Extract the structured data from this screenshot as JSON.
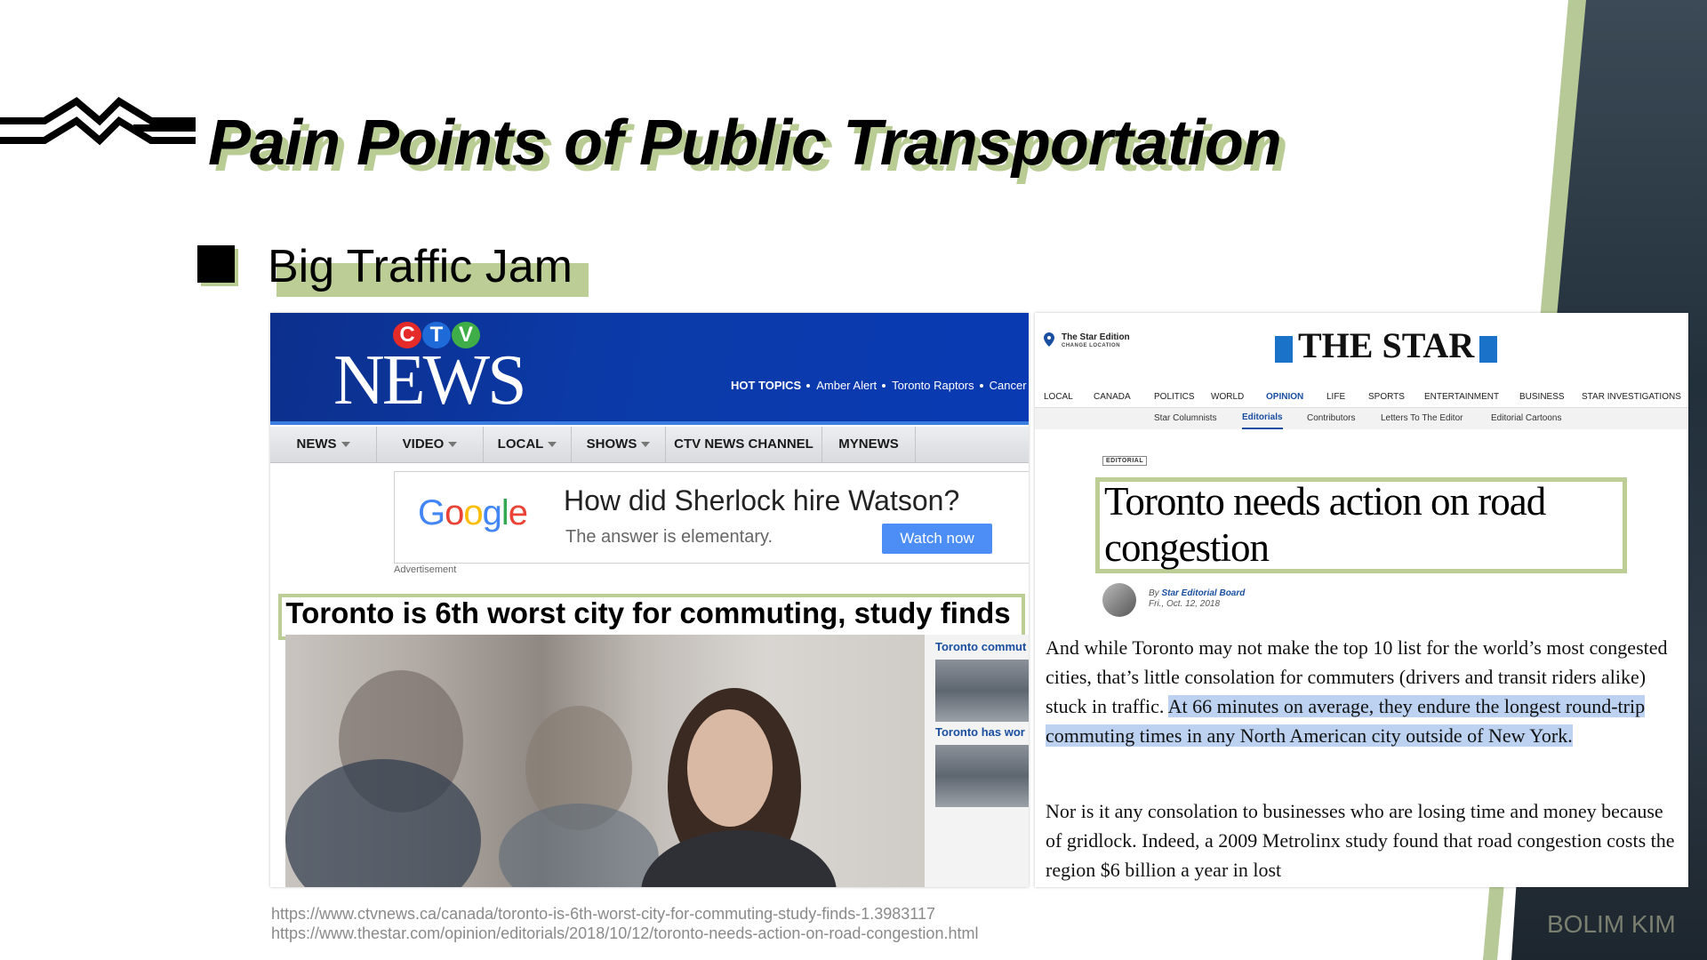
{
  "title": "Pain Points of Public Transportation",
  "subtitle": "Big Traffic Jam",
  "ctv": {
    "logo_letters": [
      "C",
      "T",
      "V"
    ],
    "logo_word": "NEWS",
    "hot_topics_label": "HOT TOPICS",
    "hot_topics": [
      "Amber Alert",
      "Toronto Raptors",
      "Cancer"
    ],
    "nav": [
      "NEWS",
      "VIDEO",
      "LOCAL",
      "SHOWS",
      "CTV NEWS CHANNEL",
      "MYNEWS"
    ],
    "ad": {
      "brand": "Google",
      "headline": "How did Sherlock hire Watson?",
      "sub": "The answer is elementary.",
      "button": "Watch now",
      "label": "Advertisement"
    },
    "headline": "Toronto is 6th worst city for commuting, study finds",
    "related": [
      "Toronto commut",
      "Toronto has wor"
    ]
  },
  "star": {
    "edition": "The Star Edition",
    "change_location": "CHANGE LOCATION",
    "logo": "THE STAR",
    "nav": [
      "LOCAL",
      "CANADA",
      "POLITICS",
      "WORLD",
      "OPINION",
      "LIFE",
      "SPORTS",
      "ENTERTAINMENT",
      "BUSINESS",
      "STAR INVESTIGATIONS"
    ],
    "active_nav": "OPINION",
    "subnav": [
      "Star Columnists",
      "Editorials",
      "Contributors",
      "Letters To The Editor",
      "Editorial Cartoons"
    ],
    "active_subnav": "Editorials",
    "tag": "EDITORIAL",
    "headline": "Toronto needs action on road congestion",
    "by": "By",
    "author": "Star Editorial Board",
    "date": "Fri., Oct. 12, 2018",
    "para1_plain": "And while Toronto may not make the top 10 list for the world’s most congested cities, that’s little consolation for commuters (drivers and transit riders alike) stuck in traffic. ",
    "para1_highlight": "At 66 minutes on average, they endure the longest round-trip commuting times in any North American city outside of New York.",
    "para2": "Nor is it any consolation to businesses who are losing time and money because of gridlock. Indeed, a 2009 Metrolinx study found that road congestion costs the region $6 billion a year in lost"
  },
  "sources": [
    "https://www.ctvnews.ca/canada/toronto-is-6th-worst-city-for-commuting-study-finds-1.3983117",
    "https://www.thestar.com/opinion/editorials/2018/10/12/toronto-needs-action-on-road-congestion.html"
  ],
  "author": "BOLIM KIM",
  "colors": {
    "accent_green": "#bccd96",
    "ctv_blue": "#0b3aa8",
    "star_blue": "#1a73c9",
    "highlight": "#bcd2f0"
  }
}
